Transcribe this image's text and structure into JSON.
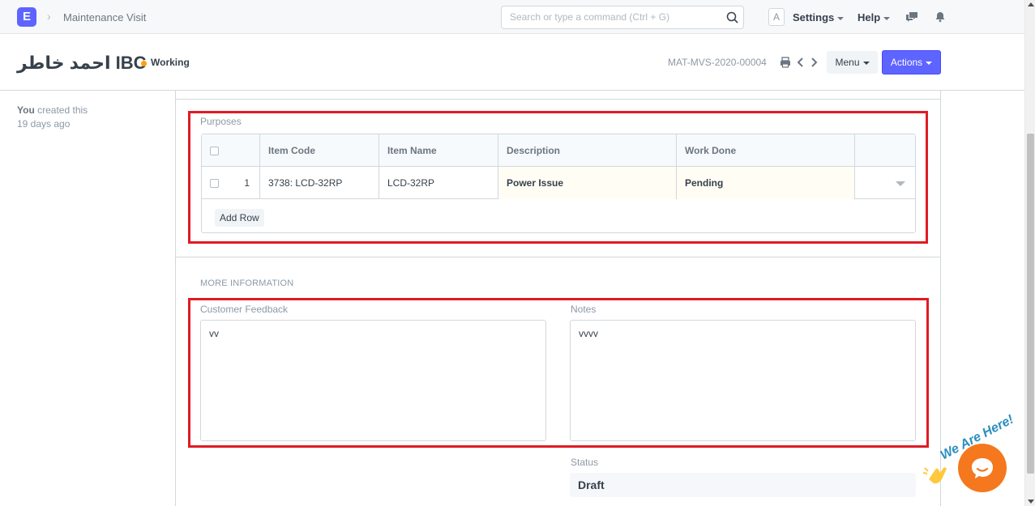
{
  "navbar": {
    "logo_letter": "E",
    "breadcrumb": "Maintenance Visit",
    "search_placeholder": "Search or type a command (Ctrl + G)",
    "avatar_letter": "A",
    "settings_label": "Settings",
    "help_label": "Help"
  },
  "header": {
    "title": "احمد خاطر IBC",
    "status": "Working",
    "status_color": "#ffa00a",
    "doc_id": "MAT-MVS-2020-00004",
    "menu_label": "Menu",
    "actions_label": "Actions"
  },
  "sidebar": {
    "creator": "You",
    "created_text": "created this",
    "created_when": "19 days ago"
  },
  "purposes": {
    "label": "Purposes",
    "columns": [
      "Item Code",
      "Item Name",
      "Description",
      "Work Done"
    ],
    "rows": [
      {
        "idx": "1",
        "item_code": "3738: LCD-32RP",
        "item_name": "LCD-32RP",
        "description": "Power Issue",
        "work_done": "Pending"
      }
    ],
    "add_row_label": "Add Row"
  },
  "more_info": {
    "section_title": "MORE INFORMATION",
    "customer_feedback_label": "Customer Feedback",
    "customer_feedback_value": "vv",
    "notes_label": "Notes",
    "notes_value": "vvvv",
    "status_label": "Status",
    "status_value": "Draft"
  },
  "chat_widget": {
    "text": "We Are Here!"
  },
  "colors": {
    "primary": "#5e64ff",
    "highlight": "#e01b24",
    "chat": "#f5781e"
  }
}
